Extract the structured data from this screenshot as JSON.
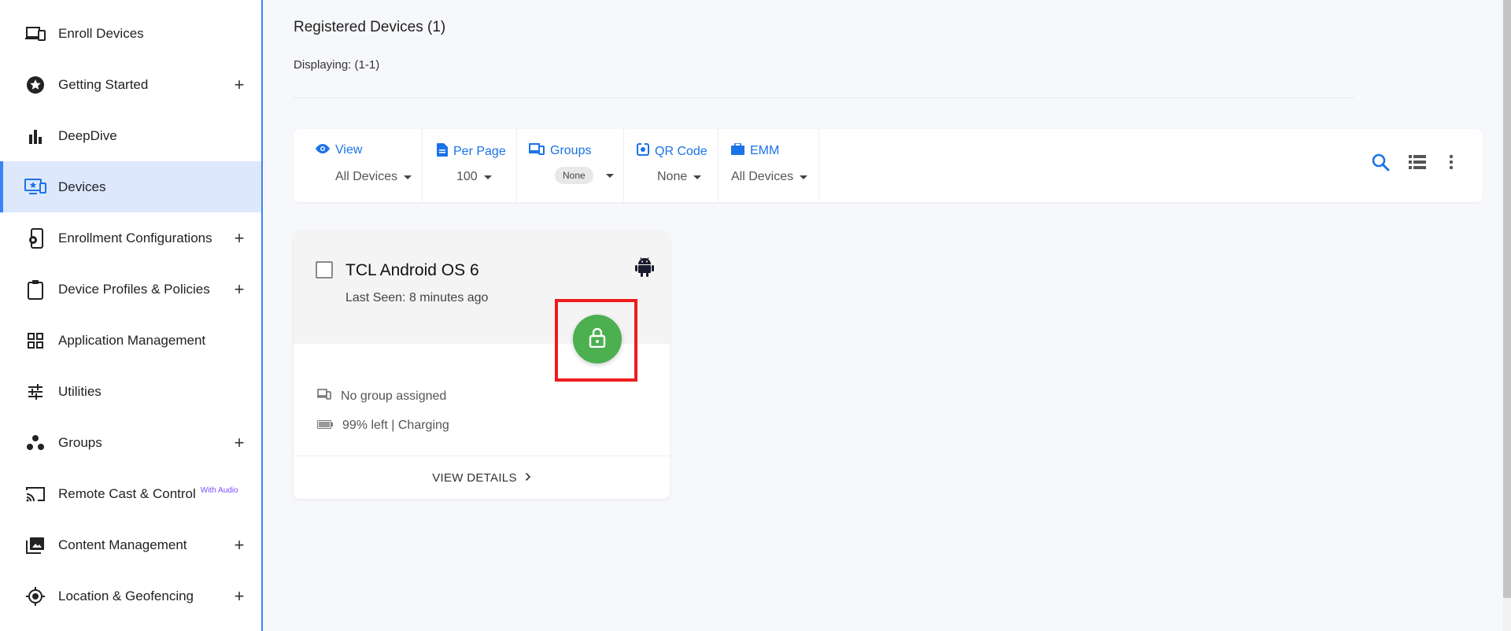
{
  "sidebar": {
    "items": [
      {
        "label": "Enroll Devices",
        "icon": "devices-icon",
        "expandable": false
      },
      {
        "label": "Getting Started",
        "icon": "star-circle-icon",
        "expandable": true
      },
      {
        "label": "DeepDive",
        "icon": "bar-chart-icon",
        "expandable": false
      },
      {
        "label": "Devices",
        "icon": "monitor-star-icon",
        "expandable": false,
        "active": true
      },
      {
        "label": "Enrollment Configurations",
        "icon": "phone-settings-icon",
        "expandable": true
      },
      {
        "label": "Device Profiles & Policies",
        "icon": "clipboard-icon",
        "expandable": true
      },
      {
        "label": "Application Management",
        "icon": "grid-icon",
        "expandable": false
      },
      {
        "label": "Utilities",
        "icon": "sliders-icon",
        "expandable": false
      },
      {
        "label": "Groups",
        "icon": "groups-icon",
        "expandable": true
      },
      {
        "label": "Remote Cast & Control",
        "badge": "With Audio",
        "icon": "cast-icon",
        "expandable": false
      },
      {
        "label": "Content Management",
        "icon": "photo-library-icon",
        "expandable": true
      },
      {
        "label": "Location & Geofencing",
        "icon": "location-icon",
        "expandable": true
      }
    ],
    "plus": "+"
  },
  "header": {
    "title": "Registered Devices (1)",
    "displaying": "Displaying: (1-1)"
  },
  "toolbar": {
    "view": {
      "label": "View",
      "value": "All Devices"
    },
    "per_page": {
      "label": "Per Page",
      "value": "100"
    },
    "groups": {
      "label": "Groups",
      "value": "None"
    },
    "qr_code": {
      "label": "QR Code",
      "value": "None"
    },
    "emm": {
      "label": "EMM",
      "value": "All Devices"
    }
  },
  "device_card": {
    "name": "TCL Android OS 6",
    "last_seen": "Last Seen: 8 minutes ago",
    "group": "No group assigned",
    "battery": "99% left | Charging",
    "view_details": "VIEW DETAILS",
    "lock_color": "#4caf50"
  },
  "colors": {
    "accent": "#1a73e8",
    "active_bg": "#dde8fd",
    "highlight": "#ee1c1c"
  }
}
